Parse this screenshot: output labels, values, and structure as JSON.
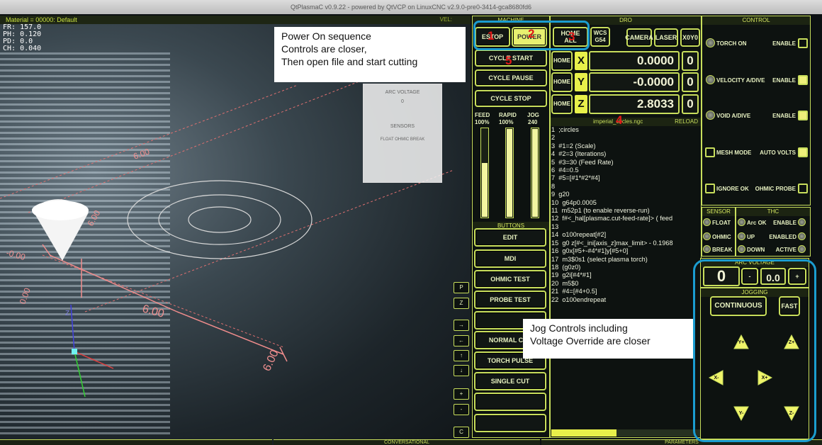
{
  "window": {
    "title": "QtPlasmaC v0.9.22 - powered by QtVCP on LinuxCNC v2.9.0-pre0-3414-gca8680fd6"
  },
  "material": {
    "label": "Material = 00000: Default",
    "vel_label": "VEL:"
  },
  "readout": {
    "lines": [
      "FR: 157.0",
      "PH: 0.120",
      "PD: 0.0",
      "CH: 0.040"
    ]
  },
  "preview": {
    "grid_labels": [
      "6.00",
      "6.00",
      "-0.00",
      "0.00",
      "6.00",
      "6.00"
    ],
    "axis_letters": [
      "Y",
      "Z"
    ]
  },
  "main_buttons": {
    "estop": "ESTOP",
    "power": "POWER",
    "home_all": "HOME ALL",
    "wcs": "WCS G54",
    "camera": "CAMERA",
    "laser": "LASER",
    "x0y0": "X0Y0",
    "cycle_start": "CYCLE START",
    "cycle_pause": "CYCLE PAUSE",
    "cycle_stop": "CYCLE STOP"
  },
  "sections": {
    "machine": "MACHINE",
    "dro": "DRO",
    "control": "CONTROL",
    "buttons": "BUTTONS",
    "sensor": "SENSOR",
    "thc": "THC",
    "arc_voltage": "ARC VOLTAGE",
    "jogging": "JOGGING",
    "conversational": "CONVERSATIONAL",
    "parameters": "PARAMETERS"
  },
  "dro": {
    "axes": [
      {
        "home": "HOME",
        "letter": "X",
        "value": "0.0000",
        "zero": "0"
      },
      {
        "home": "HOME",
        "letter": "Y",
        "value": "-0.0000",
        "zero": "0"
      },
      {
        "home": "HOME",
        "letter": "Z",
        "value": "2.8033",
        "zero": "0"
      }
    ]
  },
  "overrides": {
    "labels": [
      "FEED",
      "RAPID",
      "JOG"
    ],
    "values": [
      "100%",
      "100%",
      "240"
    ],
    "levels": [
      0.62,
      1.0,
      1.0
    ]
  },
  "file": {
    "name": "imperial_circles.ngc",
    "reload": "RELOAD"
  },
  "gcode_lines": [
    "1  ;circles",
    "2",
    "3  #1=2 (Scale)",
    "4  #2=3 (Iterations)",
    "5  #3=30 (Feed Rate)",
    "6  #4=0.5",
    "7  #5=[#1*#2*#4]",
    "8",
    "9  g20",
    "10  g64p0.0005",
    "11  m52p1 (to enable reverse-run)",
    "12  f#<_hal[plasmac.cut-feed-rate]> ( feed",
    "13",
    "14  o100repeat[#2]",
    "15  g0 z[#<_ini[axis_z]max_limit> - 0.1968",
    "16  g0x[#5+-#4*#1]y[#5+0]",
    "17  m3$0s1 (select plasma torch)",
    "18  (g0z0)",
    "19  g2i[#4*#1]",
    "20  m5$0",
    "21  #4=[#4+0.5]",
    "22  o100endrepeat"
  ],
  "user_buttons": [
    "EDIT",
    "MDI",
    "OHMIC TEST",
    "PROBE TEST",
    "",
    "NORMAL CUT",
    "TORCH PULSE",
    "SINGLE CUT",
    "",
    ""
  ],
  "control": {
    "rows": [
      {
        "label": "TORCH ON",
        "right": "ENABLE",
        "checked": false
      },
      {
        "label": "VELOCITY A/DIVE",
        "right": "ENABLE",
        "checked": true
      },
      {
        "label": "VOID A/DIVE",
        "right": "ENABLE",
        "checked": true
      },
      {
        "label": "MESH MODE",
        "right": "AUTO VOLTS",
        "checked": true
      },
      {
        "label": "IGNORE OK",
        "right": "OHMIC PROBE",
        "checked": false
      }
    ]
  },
  "sensor": {
    "items": [
      "FLOAT",
      "OHMIC",
      "BREAK"
    ]
  },
  "thc": {
    "left": [
      "Arc OK",
      "UP",
      "DOWN"
    ],
    "right": [
      "ENABLE",
      "ENABLED",
      "ACTIVE"
    ]
  },
  "arc_voltage": {
    "value": "0",
    "minus": "-",
    "offset": "0.0",
    "plus": "+"
  },
  "jogging": {
    "mode": "CONTINUOUS",
    "speed": "FAST",
    "keys": [
      "Y+",
      "Z+",
      "X-",
      "X+",
      "Y-",
      "Z-"
    ]
  },
  "side_buttons": [
    "P",
    "Z",
    "→",
    "←",
    "↑",
    "↓",
    "+",
    "-",
    "C"
  ],
  "preview_inset": {
    "lines": [
      "ARC VOLTAGE",
      "0",
      "SENSORS",
      "FLOAT  OHMIC  BREAK"
    ]
  },
  "annotations": {
    "power_on": [
      "Power On sequence",
      "Controls are closer,",
      "Then open file and start cutting"
    ],
    "jog": [
      "Jog Controls including",
      "Voltage Override are closer"
    ],
    "numbers": [
      "1",
      "2",
      "3",
      "4",
      "5"
    ]
  },
  "colors": {
    "accent": "#c8de5c",
    "highlight": "#e8f04a",
    "annotation_box": "#1b9cd0",
    "annotation_number": "#e01818"
  }
}
